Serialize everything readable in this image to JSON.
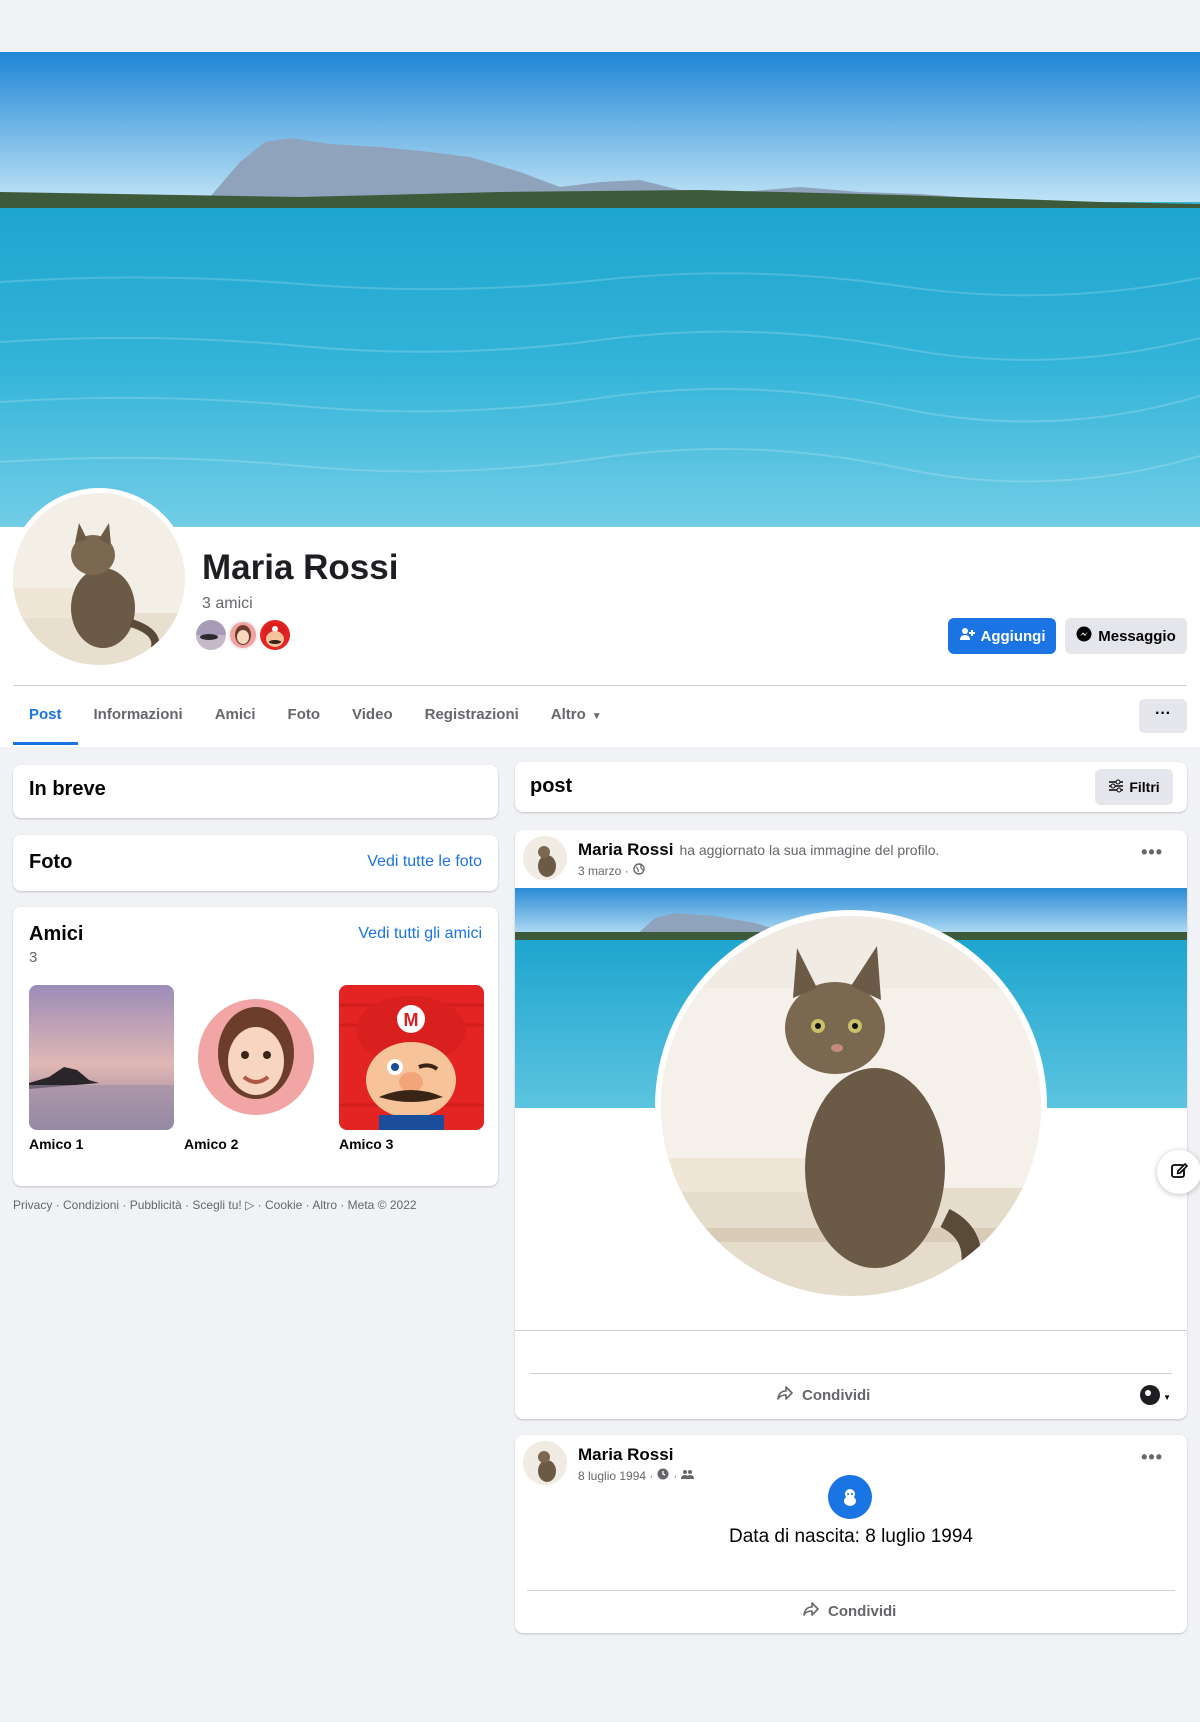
{
  "profile": {
    "name": "Maria Rossi",
    "friends_count": "3 amici"
  },
  "actions": {
    "add_label": "Aggiungi",
    "message_label": "Messaggio"
  },
  "tabs": [
    {
      "label": "Post"
    },
    {
      "label": "Informazioni"
    },
    {
      "label": "Amici"
    },
    {
      "label": "Foto"
    },
    {
      "label": "Video"
    },
    {
      "label": "Registrazioni"
    },
    {
      "label": "Altro"
    }
  ],
  "more_label": "···",
  "intro": {
    "title": "In breve"
  },
  "photos": {
    "title": "Foto",
    "link": "Vedi tutte le foto"
  },
  "friends": {
    "title": "Amici",
    "count": "3",
    "link": "Vedi tutti gli amici",
    "items": [
      {
        "name": "Amico 1"
      },
      {
        "name": "Amico 2"
      },
      {
        "name": "Amico 3"
      }
    ]
  },
  "footer": "Privacy · Condizioni · Pubblicità · Scegli tu! ▷ · Cookie · Altro · Meta © 2022",
  "feed": {
    "title": "post",
    "filters_label": "Filtri"
  },
  "posts": [
    {
      "author": "Maria Rossi",
      "action": "ha aggiornato la sua immagine del profilo.",
      "date": "3 marzo ·",
      "share_label": "Condividi"
    },
    {
      "author": "Maria Rossi",
      "date": "8 luglio 1994 ·",
      "body": "Data di nascita: 8 luglio 1994",
      "share_label": "Condividi"
    }
  ],
  "icons": {
    "add_friend": "add-friend-icon",
    "messenger": "messenger-icon",
    "filters": "sliders-icon",
    "globe": "globe-icon",
    "share": "share-icon",
    "edit": "edit-icon",
    "birthday": "baby-icon"
  },
  "colors": {
    "accent": "#1b74e4",
    "background": "#f0f2f5"
  }
}
